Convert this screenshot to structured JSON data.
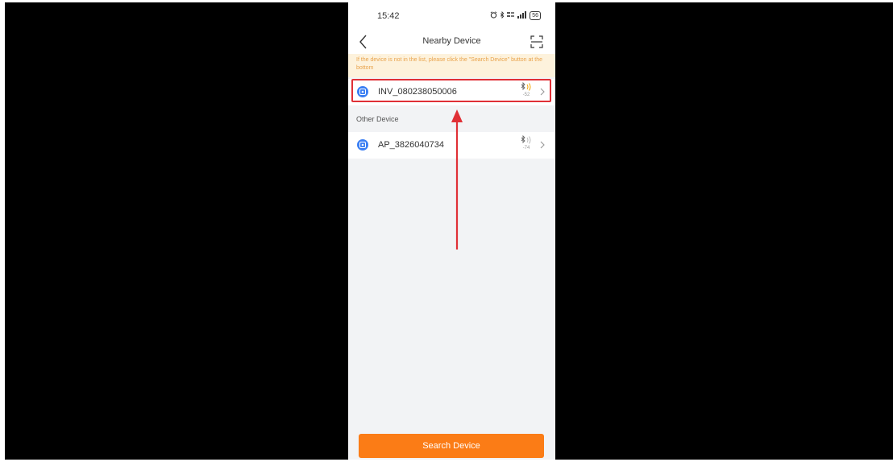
{
  "status": {
    "time": "15:42",
    "network": "5G",
    "battery": "56"
  },
  "nav": {
    "title": "Nearby Device"
  },
  "tip": {
    "text": "If the device is not in the list, please click the \"Search Device\" button at the bottom"
  },
  "devices": [
    {
      "name": "INV_080238050006",
      "rssi": "-52",
      "highlighted": true
    },
    {
      "name": "AP_3826040734",
      "rssi": "-74",
      "highlighted": false
    }
  ],
  "sections": {
    "other": "Other Device"
  },
  "actions": {
    "search_label": "Search Device"
  },
  "colors": {
    "accent": "#fb7c16",
    "highlight": "#e03036",
    "device_icon": "#3b7ff3",
    "tip_text": "#e9a24a",
    "tip_bg": "#fdf2dc"
  },
  "icons": {
    "back": "chevron-left-icon",
    "scan": "scan-icon",
    "device": "device-icon",
    "signal": "bluetooth-signal-icon",
    "chevron": "chevron-right-icon"
  }
}
